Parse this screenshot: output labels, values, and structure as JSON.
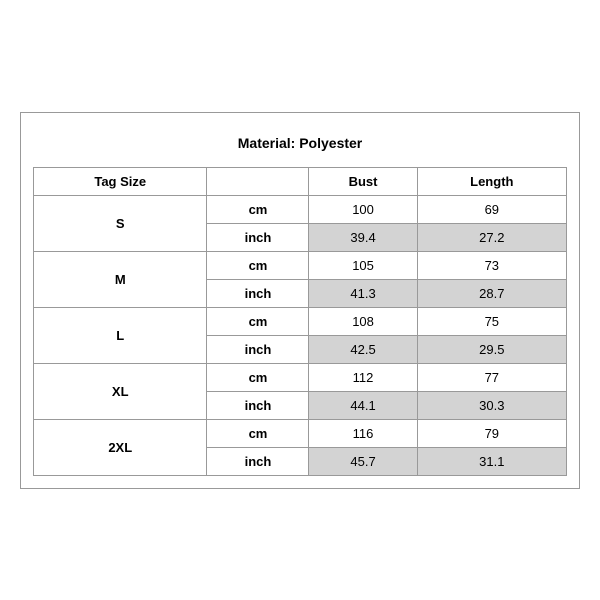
{
  "title": "Material: Polyester",
  "columns": {
    "tagSize": "Tag Size",
    "bust": "Bust",
    "length": "Length"
  },
  "rows": [
    {
      "size": "S",
      "cm": {
        "bust": "100",
        "length": "69"
      },
      "inch": {
        "bust": "39.4",
        "length": "27.2"
      }
    },
    {
      "size": "M",
      "cm": {
        "bust": "105",
        "length": "73"
      },
      "inch": {
        "bust": "41.3",
        "length": "28.7"
      }
    },
    {
      "size": "L",
      "cm": {
        "bust": "108",
        "length": "75"
      },
      "inch": {
        "bust": "42.5",
        "length": "29.5"
      }
    },
    {
      "size": "XL",
      "cm": {
        "bust": "112",
        "length": "77"
      },
      "inch": {
        "bust": "44.1",
        "length": "30.3"
      }
    },
    {
      "size": "2XL",
      "cm": {
        "bust": "116",
        "length": "79"
      },
      "inch": {
        "bust": "45.7",
        "length": "31.1"
      }
    }
  ]
}
